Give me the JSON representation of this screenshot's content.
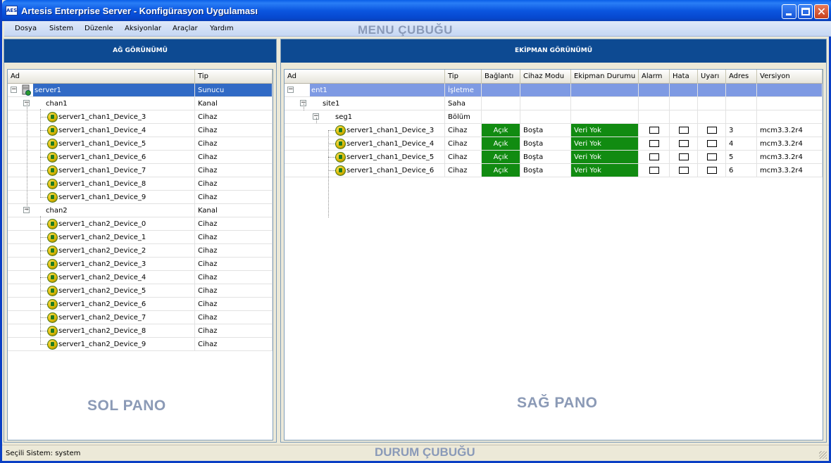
{
  "window": {
    "app_icon_text": "AES",
    "title": "Artesis Enterprise Server - Konfigürasyon Uygulaması"
  },
  "menu": {
    "items": [
      "Dosya",
      "Sistem",
      "Düzenle",
      "Aksiyonlar",
      "Araçlar",
      "Yardım"
    ],
    "overlay_label": "MENU ÇUBUĞU"
  },
  "left_pane": {
    "header": "AĞ GÖRÜNÜMÜ",
    "columns": [
      "Ad",
      "Tip"
    ],
    "overlay_label": "SOL PANO",
    "rows": [
      {
        "name": "server1",
        "type": "Sunucu"
      },
      {
        "name": "chan1",
        "type": "Kanal"
      },
      {
        "name": "server1_chan1_Device_3",
        "type": "Cihaz"
      },
      {
        "name": "server1_chan1_Device_4",
        "type": "Cihaz"
      },
      {
        "name": "server1_chan1_Device_5",
        "type": "Cihaz"
      },
      {
        "name": "server1_chan1_Device_6",
        "type": "Cihaz"
      },
      {
        "name": "server1_chan1_Device_7",
        "type": "Cihaz"
      },
      {
        "name": "server1_chan1_Device_8",
        "type": "Cihaz"
      },
      {
        "name": "server1_chan1_Device_9",
        "type": "Cihaz"
      },
      {
        "name": "chan2",
        "type": "Kanal"
      },
      {
        "name": "server1_chan2_Device_0",
        "type": "Cihaz"
      },
      {
        "name": "server1_chan2_Device_1",
        "type": "Cihaz"
      },
      {
        "name": "server1_chan2_Device_2",
        "type": "Cihaz"
      },
      {
        "name": "server1_chan2_Device_3",
        "type": "Cihaz"
      },
      {
        "name": "server1_chan2_Device_4",
        "type": "Cihaz"
      },
      {
        "name": "server1_chan2_Device_5",
        "type": "Cihaz"
      },
      {
        "name": "server1_chan2_Device_6",
        "type": "Cihaz"
      },
      {
        "name": "server1_chan2_Device_7",
        "type": "Cihaz"
      },
      {
        "name": "server1_chan2_Device_8",
        "type": "Cihaz"
      },
      {
        "name": "server1_chan2_Device_9",
        "type": "Cihaz"
      }
    ]
  },
  "right_pane": {
    "header": "EKİPMAN GÖRÜNÜMÜ",
    "columns": [
      "Ad",
      "Tip",
      "Bağlantı",
      "Cihaz Modu",
      "Ekipman Durumu",
      "Alarm",
      "Hata",
      "Uyarı",
      "Adres",
      "Versiyon"
    ],
    "overlay_label": "SAĞ PANO",
    "rows": [
      {
        "name": "ent1",
        "type": "İşletme"
      },
      {
        "name": "site1",
        "type": "Saha"
      },
      {
        "name": "seg1",
        "type": "Bölüm"
      },
      {
        "name": "server1_chan1_Device_3",
        "type": "Cihaz",
        "connection": "Açık",
        "mode": "Boşta",
        "status": "Veri Yok",
        "address": "3",
        "version": "mcm3.3.2r4"
      },
      {
        "name": "server1_chan1_Device_4",
        "type": "Cihaz",
        "connection": "Açık",
        "mode": "Boşta",
        "status": "Veri Yok",
        "address": "4",
        "version": "mcm3.3.2r4"
      },
      {
        "name": "server1_chan1_Device_5",
        "type": "Cihaz",
        "connection": "Açık",
        "mode": "Boşta",
        "status": "Veri Yok",
        "address": "5",
        "version": "mcm3.3.2r4"
      },
      {
        "name": "server1_chan1_Device_6",
        "type": "Cihaz",
        "connection": "Açık",
        "mode": "Boşta",
        "status": "Veri Yok",
        "address": "6",
        "version": "mcm3.3.2r4"
      }
    ]
  },
  "statusbar": {
    "text": "Seçili Sistem: system",
    "overlay_label": "DURUM ÇUBUĞU"
  },
  "colors": {
    "pane_header": "#0d4a92",
    "selection": "#316ac5",
    "status_green": "#118b11"
  }
}
